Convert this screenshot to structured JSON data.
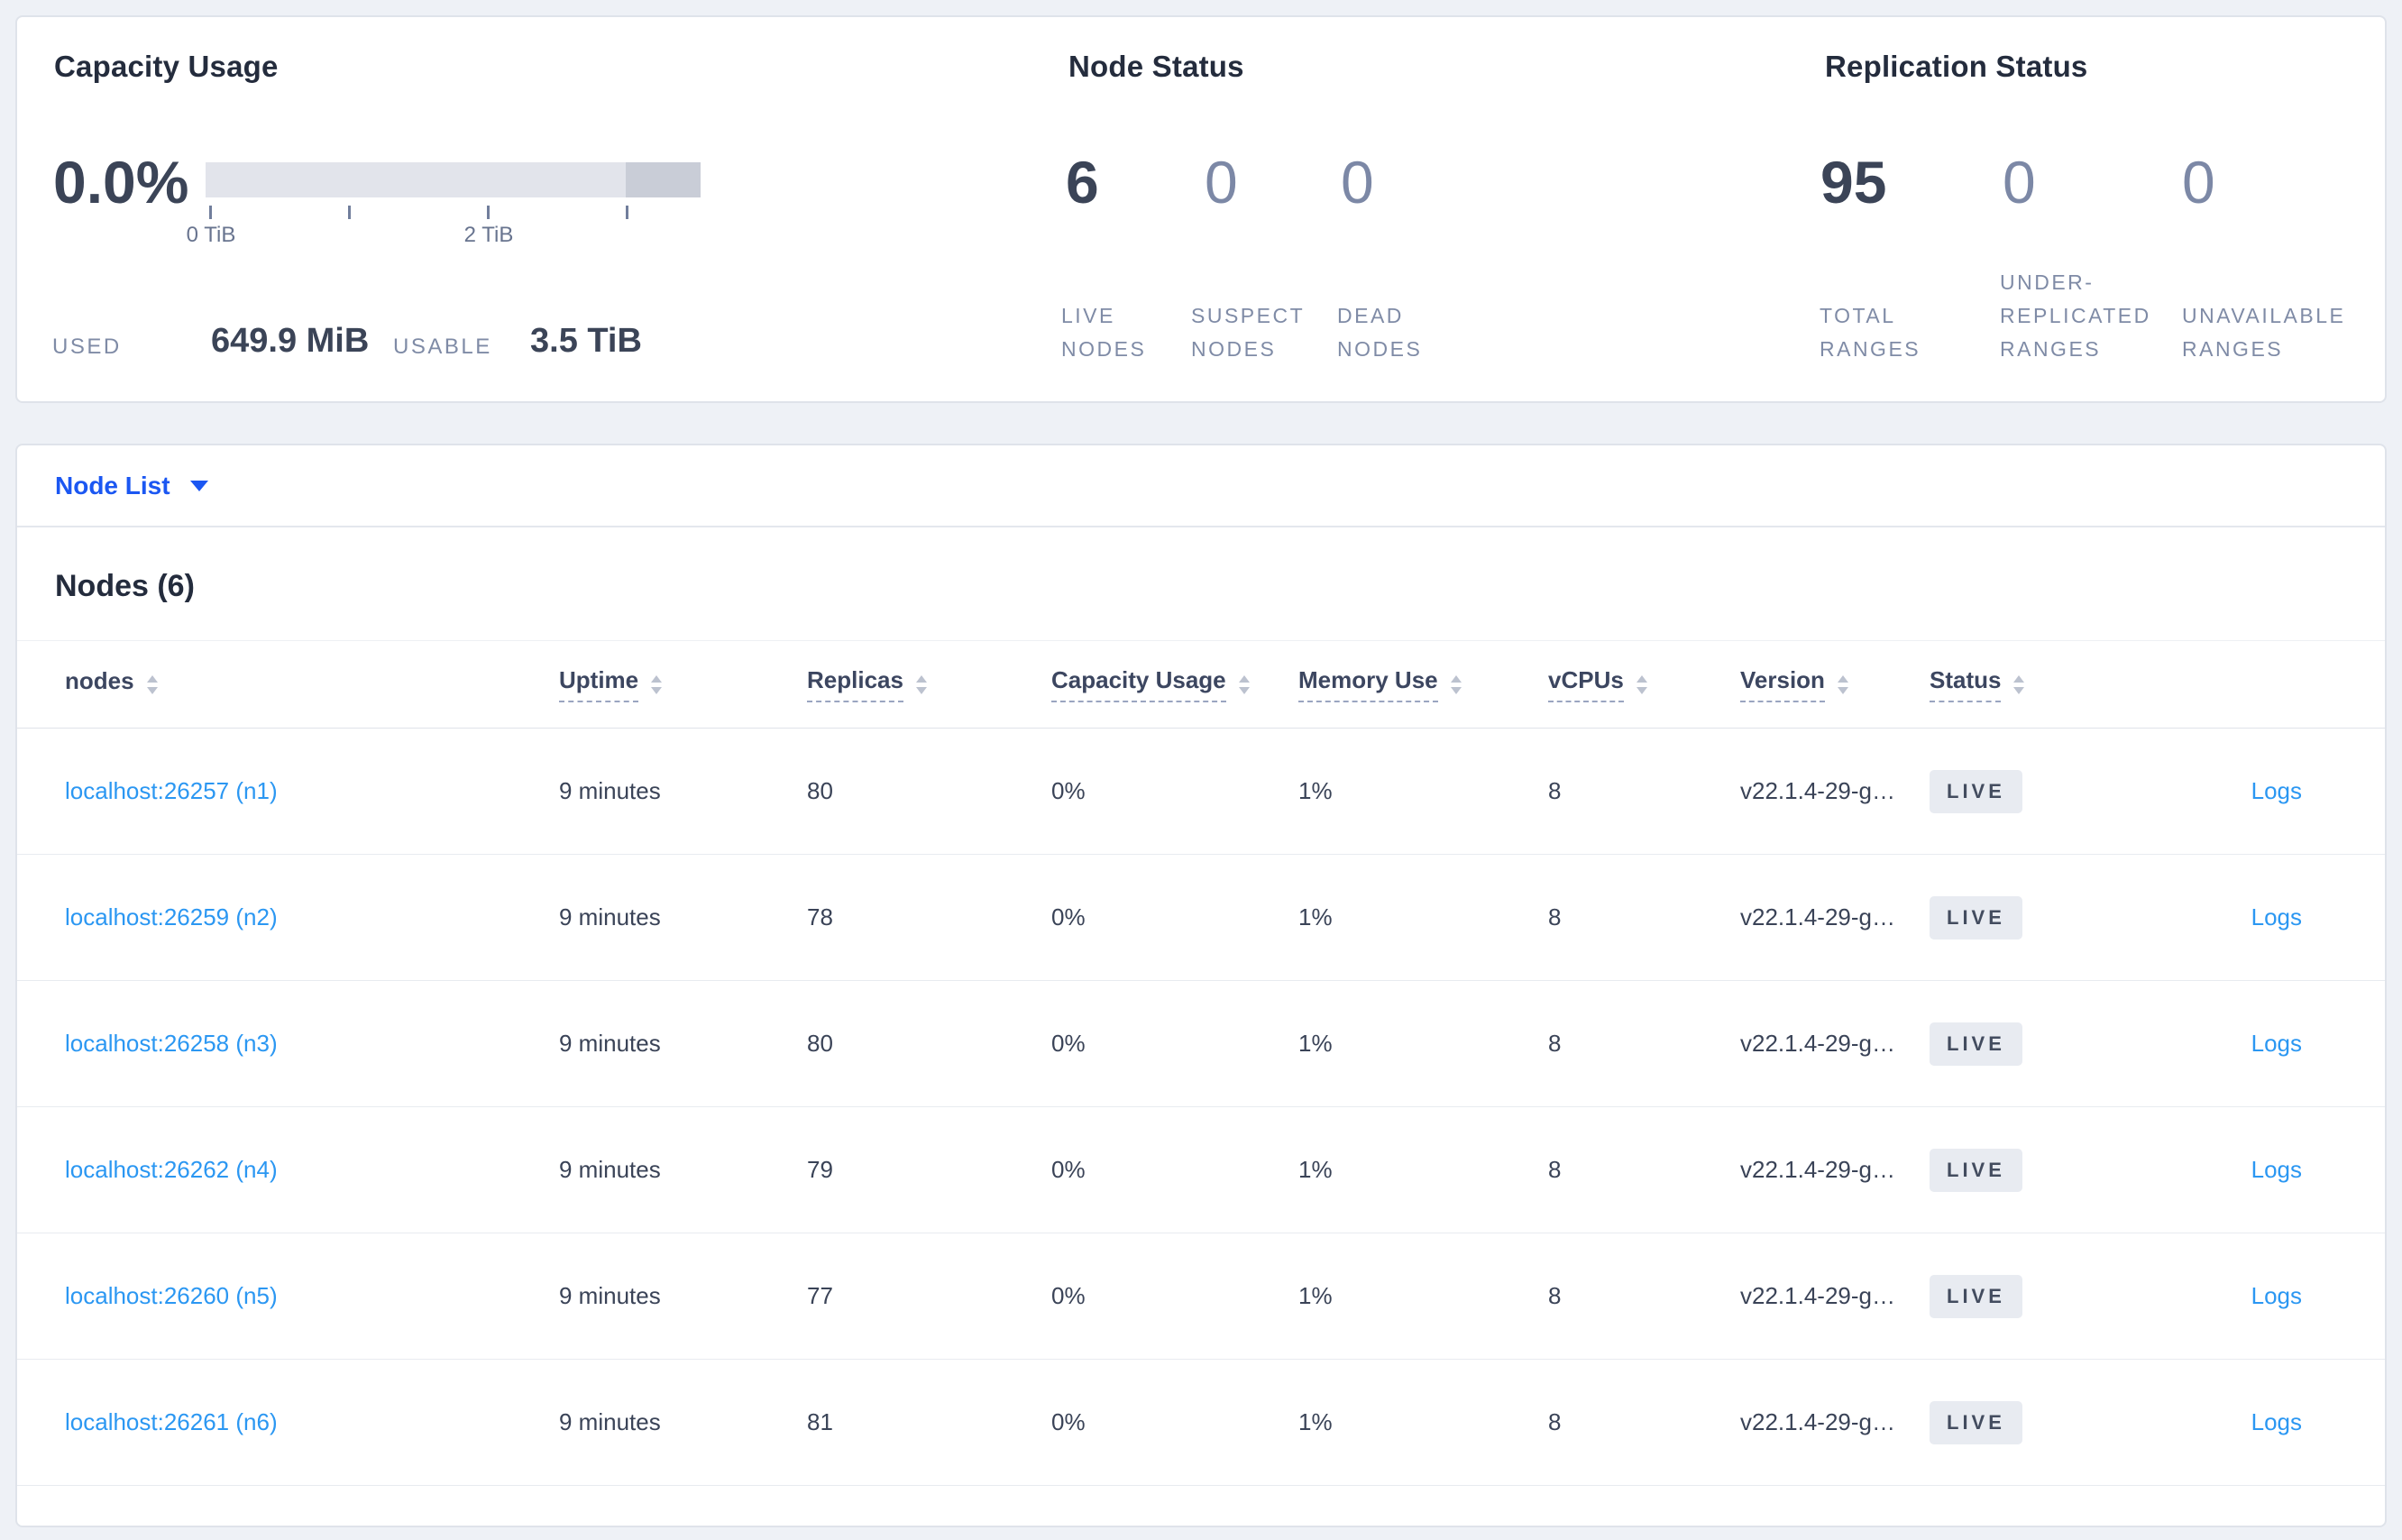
{
  "colors": {
    "accent_link": "#2b97f2",
    "dropdown_blue": "#1b57f2",
    "dark_text": "#3b4457",
    "muted_stat": "#7c88a6",
    "badge_bg": "#e8ebf1",
    "bar_light": "#e2e4eb",
    "bar_dark": "#c9cdd7"
  },
  "capacity": {
    "title": "Capacity Usage",
    "percent": "0.0%",
    "used_percent": 0.0,
    "axis_ticks": [
      "0 TiB",
      "1 TiB",
      "2 TiB",
      "3 TiB"
    ],
    "tick_label_0": "0 TiB",
    "tick_label_2": "2 TiB",
    "used_label": "USED",
    "used_value": "649.9 MiB",
    "usable_label": "USABLE",
    "usable_value": "3.5 TiB"
  },
  "node_status": {
    "title": "Node Status",
    "stats": [
      {
        "value": "6",
        "label": "LIVE NODES"
      },
      {
        "value": "0",
        "label": "SUSPECT NODES"
      },
      {
        "value": "0",
        "label": "DEAD NODES"
      }
    ]
  },
  "replication_status": {
    "title": "Replication Status",
    "stats": [
      {
        "value": "95",
        "label": "TOTAL RANGES"
      },
      {
        "value": "0",
        "label": "UNDER-REPLICATED RANGES"
      },
      {
        "value": "0",
        "label": "UNAVAILABLE RANGES"
      }
    ]
  },
  "node_list_dropdown": {
    "label": "Node List"
  },
  "nodes_table": {
    "title": "Nodes (6)",
    "columns": [
      {
        "label": "nodes"
      },
      {
        "label": "Uptime"
      },
      {
        "label": "Replicas"
      },
      {
        "label": "Capacity Usage"
      },
      {
        "label": "Memory Use"
      },
      {
        "label": "vCPUs"
      },
      {
        "label": "Version"
      },
      {
        "label": "Status"
      },
      {
        "label": ""
      }
    ],
    "rows": [
      {
        "address": "localhost:26257 (n1)",
        "uptime": "9 minutes",
        "replicas": "80",
        "capacity_usage": "0%",
        "memory_use": "1%",
        "vcpus": "8",
        "version": "v22.1.4-29-g…",
        "status": "LIVE",
        "logs_label": "Logs"
      },
      {
        "address": "localhost:26259 (n2)",
        "uptime": "9 minutes",
        "replicas": "78",
        "capacity_usage": "0%",
        "memory_use": "1%",
        "vcpus": "8",
        "version": "v22.1.4-29-g…",
        "status": "LIVE",
        "logs_label": "Logs"
      },
      {
        "address": "localhost:26258 (n3)",
        "uptime": "9 minutes",
        "replicas": "80",
        "capacity_usage": "0%",
        "memory_use": "1%",
        "vcpus": "8",
        "version": "v22.1.4-29-g…",
        "status": "LIVE",
        "logs_label": "Logs"
      },
      {
        "address": "localhost:26262 (n4)",
        "uptime": "9 minutes",
        "replicas": "79",
        "capacity_usage": "0%",
        "memory_use": "1%",
        "vcpus": "8",
        "version": "v22.1.4-29-g…",
        "status": "LIVE",
        "logs_label": "Logs"
      },
      {
        "address": "localhost:26260 (n5)",
        "uptime": "9 minutes",
        "replicas": "77",
        "capacity_usage": "0%",
        "memory_use": "1%",
        "vcpus": "8",
        "version": "v22.1.4-29-g…",
        "status": "LIVE",
        "logs_label": "Logs"
      },
      {
        "address": "localhost:26261 (n6)",
        "uptime": "9 minutes",
        "replicas": "81",
        "capacity_usage": "0%",
        "memory_use": "1%",
        "vcpus": "8",
        "version": "v22.1.4-29-g…",
        "status": "LIVE",
        "logs_label": "Logs"
      }
    ]
  }
}
